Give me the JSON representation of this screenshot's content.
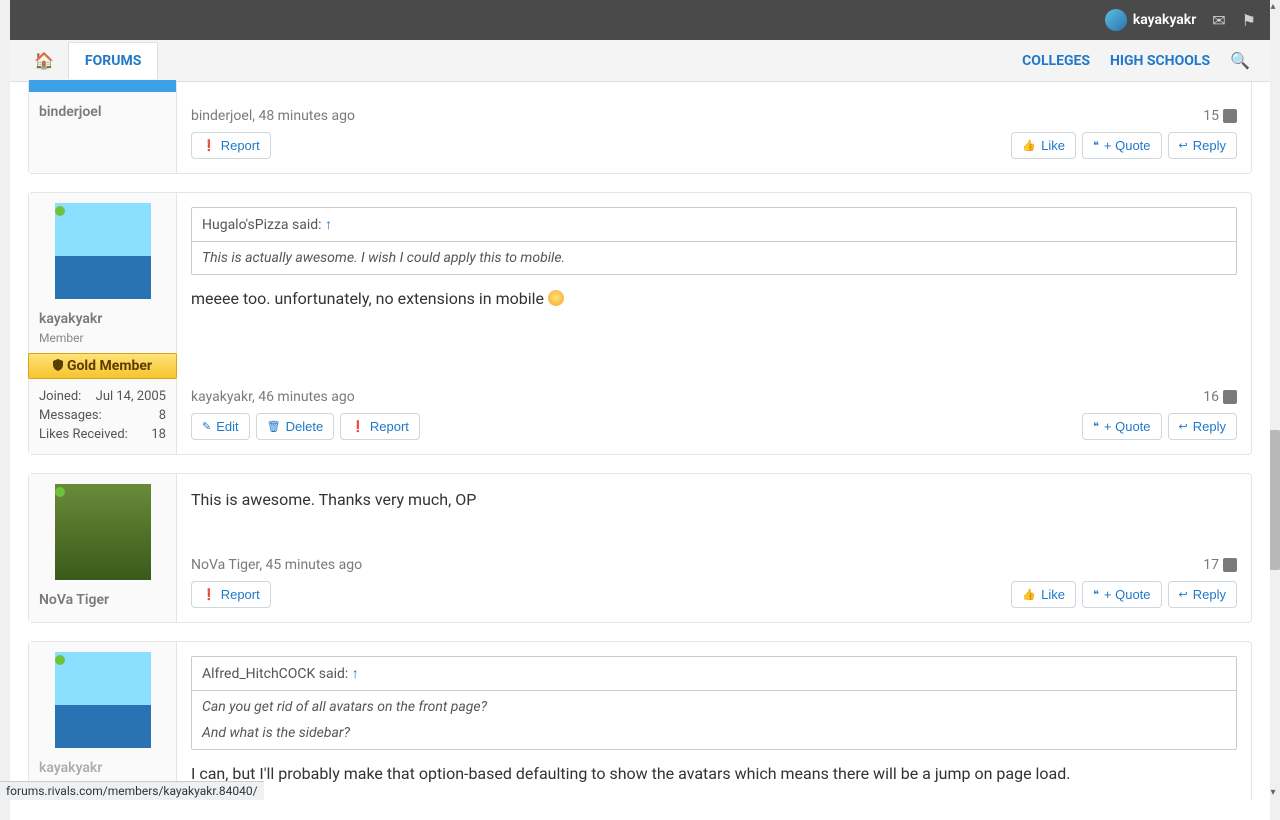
{
  "header": {
    "username": "kayakyakr"
  },
  "nav": {
    "forums": "FORUMS",
    "colleges": "COLLEGES",
    "highschools": "HIGH SCHOOLS"
  },
  "actions": {
    "report": "Report",
    "like": "Like",
    "quote": "+ Quote",
    "reply": "Reply",
    "edit": "Edit",
    "delete": "Delete"
  },
  "labels": {
    "joined": "Joined:",
    "messages": "Messages:",
    "likes_received": "Likes Received:",
    "member": "Member",
    "gold": "Gold Member"
  },
  "posts": [
    {
      "user": "binderjoel",
      "meta": "binderjoel, 48 minutes ago",
      "num": "15"
    },
    {
      "user": "kayakyakr",
      "role": "Member",
      "joined": "Jul 14, 2005",
      "messages": "8",
      "likes": "18",
      "quote_author": "Hugalo'sPizza said: ",
      "quote_link": "↑",
      "quote_body": "This is actually awesome. I wish I could apply this to mobile.",
      "body": "meeee too. unfortunately, no extensions in mobile ",
      "meta": "kayakyakr, 46 minutes ago",
      "num": "16"
    },
    {
      "user": "NoVa Tiger",
      "body": "This is awesome. Thanks very much, OP",
      "meta": "NoVa Tiger, 45 minutes ago",
      "num": "17"
    },
    {
      "user": "kayakyakr",
      "quote_author": "Alfred_HitchCOCK said: ",
      "quote_link": "↑",
      "quote_body1": "Can you get rid of all avatars on the front page?",
      "quote_body2": "And what is the sidebar?",
      "body": "I can, but I'll probably make that option-based defaulting to show the avatars which means there will be a jump on page load."
    }
  ],
  "statusbar": "forums.rivals.com/members/kayakyakr.84040/"
}
